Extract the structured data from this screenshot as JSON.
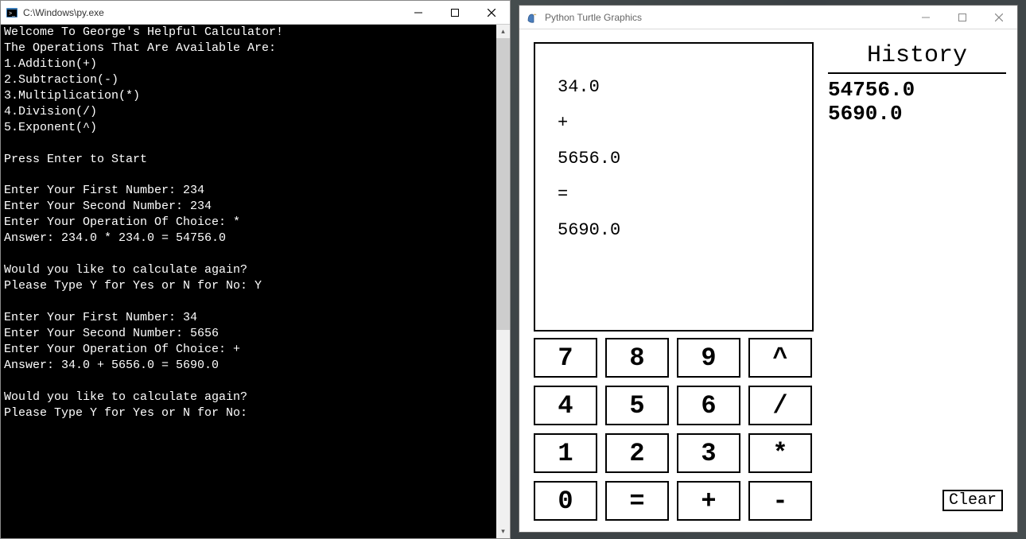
{
  "console": {
    "title": "C:\\Windows\\py.exe",
    "lines": [
      "Welcome To George's Helpful Calculator!",
      "The Operations That Are Available Are:",
      "1.Addition(+)",
      "2.Subtraction(-)",
      "3.Multiplication(*)",
      "4.Division(/)",
      "5.Exponent(^)",
      "",
      "Press Enter to Start",
      "",
      "Enter Your First Number: 234",
      "Enter Your Second Number: 234",
      "Enter Your Operation Of Choice: *",
      "Answer: 234.0 * 234.0 = 54756.0",
      "",
      "Would you like to calculate again?",
      "Please Type Y for Yes or N for No: Y",
      "",
      "Enter Your First Number: 34",
      "Enter Your Second Number: 5656",
      "Enter Your Operation Of Choice: +",
      "Answer: 34.0 + 5656.0 = 5690.0",
      "",
      "Would you like to calculate again?",
      "Please Type Y for Yes or N for No:"
    ]
  },
  "turtle": {
    "title": "Python Turtle Graphics",
    "display_lines": [
      "34.0",
      "+",
      "5656.0",
      "=",
      "5690.0"
    ],
    "history_title": "History",
    "history": [
      "54756.0",
      "5690.0"
    ],
    "keys": [
      "7",
      "8",
      "9",
      "^",
      "4",
      "5",
      "6",
      "/",
      "1",
      "2",
      "3",
      "*",
      "0",
      "=",
      "+",
      "-"
    ],
    "clear_label": "Clear"
  }
}
